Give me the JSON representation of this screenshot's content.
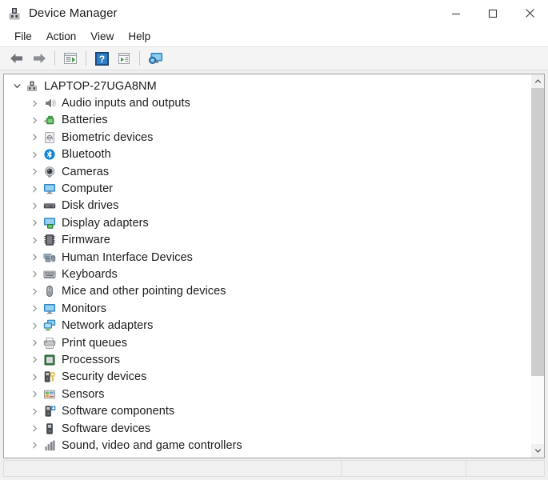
{
  "window": {
    "title": "Device Manager",
    "title_icon": "device-manager-icon",
    "controls": [
      {
        "name": "minimize-button",
        "glyph": "minimize"
      },
      {
        "name": "maximize-button",
        "glyph": "maximize"
      },
      {
        "name": "close-button",
        "glyph": "close"
      }
    ]
  },
  "menubar": {
    "items": [
      {
        "label": "File",
        "name": "menu-file"
      },
      {
        "label": "Action",
        "name": "menu-action"
      },
      {
        "label": "View",
        "name": "menu-view"
      },
      {
        "label": "Help",
        "name": "menu-help"
      }
    ]
  },
  "toolbar": {
    "buttons": [
      {
        "name": "back-button",
        "icon": "back-arrow-icon"
      },
      {
        "name": "forward-button",
        "icon": "forward-arrow-icon"
      },
      {
        "name": "separator-1",
        "icon": "separator"
      },
      {
        "name": "properties-button",
        "icon": "properties-icon"
      },
      {
        "name": "separator-2",
        "icon": "separator"
      },
      {
        "name": "help-button",
        "icon": "help-icon"
      },
      {
        "name": "update-driver-button",
        "icon": "update-driver-icon"
      },
      {
        "name": "separator-3",
        "icon": "separator"
      },
      {
        "name": "scan-hardware-button",
        "icon": "scan-hardware-icon"
      }
    ]
  },
  "tree": {
    "root": {
      "label": "LAPTOP-27UGA8NM",
      "expanded": true,
      "icon": "computer-node-icon",
      "chevron": "chevron-down-icon"
    },
    "items": [
      {
        "label": "Audio inputs and outputs",
        "icon": "speaker-icon",
        "chevron": "chevron-right-icon"
      },
      {
        "label": "Batteries",
        "icon": "battery-icon",
        "chevron": "chevron-right-icon"
      },
      {
        "label": "Biometric devices",
        "icon": "fingerprint-icon",
        "chevron": "chevron-right-icon"
      },
      {
        "label": "Bluetooth",
        "icon": "bluetooth-icon",
        "chevron": "chevron-right-icon"
      },
      {
        "label": "Cameras",
        "icon": "camera-icon",
        "chevron": "chevron-right-icon"
      },
      {
        "label": "Computer",
        "icon": "monitor-icon",
        "chevron": "chevron-right-icon"
      },
      {
        "label": "Disk drives",
        "icon": "disk-drive-icon",
        "chevron": "chevron-right-icon"
      },
      {
        "label": "Display adapters",
        "icon": "display-adapter-icon",
        "chevron": "chevron-right-icon"
      },
      {
        "label": "Firmware",
        "icon": "firmware-chip-icon",
        "chevron": "chevron-right-icon"
      },
      {
        "label": "Human Interface Devices",
        "icon": "hid-icon",
        "chevron": "chevron-right-icon"
      },
      {
        "label": "Keyboards",
        "icon": "keyboard-icon",
        "chevron": "chevron-right-icon"
      },
      {
        "label": "Mice and other pointing devices",
        "icon": "mouse-icon",
        "chevron": "chevron-right-icon"
      },
      {
        "label": "Monitors",
        "icon": "monitor-icon",
        "chevron": "chevron-right-icon"
      },
      {
        "label": "Network adapters",
        "icon": "network-adapter-icon",
        "chevron": "chevron-right-icon"
      },
      {
        "label": "Print queues",
        "icon": "printer-icon",
        "chevron": "chevron-right-icon"
      },
      {
        "label": "Processors",
        "icon": "processor-icon",
        "chevron": "chevron-right-icon"
      },
      {
        "label": "Security devices",
        "icon": "security-key-icon",
        "chevron": "chevron-right-icon"
      },
      {
        "label": "Sensors",
        "icon": "sensor-icon",
        "chevron": "chevron-right-icon"
      },
      {
        "label": "Software components",
        "icon": "software-component-icon",
        "chevron": "chevron-right-icon"
      },
      {
        "label": "Software devices",
        "icon": "software-device-icon",
        "chevron": "chevron-right-icon"
      },
      {
        "label": "Sound, video and game controllers",
        "icon": "sound-controller-icon",
        "chevron": "chevron-right-icon"
      }
    ]
  },
  "scrollbar": {
    "up_arrow": "chevron-up-icon",
    "down_arrow": "chevron-down-icon",
    "thumb_fraction": 0.81
  },
  "statusbar": {
    "panels": [
      "",
      "",
      ""
    ]
  },
  "colors": {
    "accent_blue": "#1f8ad2",
    "bluetooth_blue": "#0b7fd4",
    "battery_green": "#3e9b3e",
    "processor_green": "#2d7a3a",
    "key_yellow": "#e8c44a",
    "window_bg": "#f0f0f0",
    "panel_bg": "#ffffff",
    "border": "#a0a0a0",
    "text": "#1c1c1c"
  }
}
